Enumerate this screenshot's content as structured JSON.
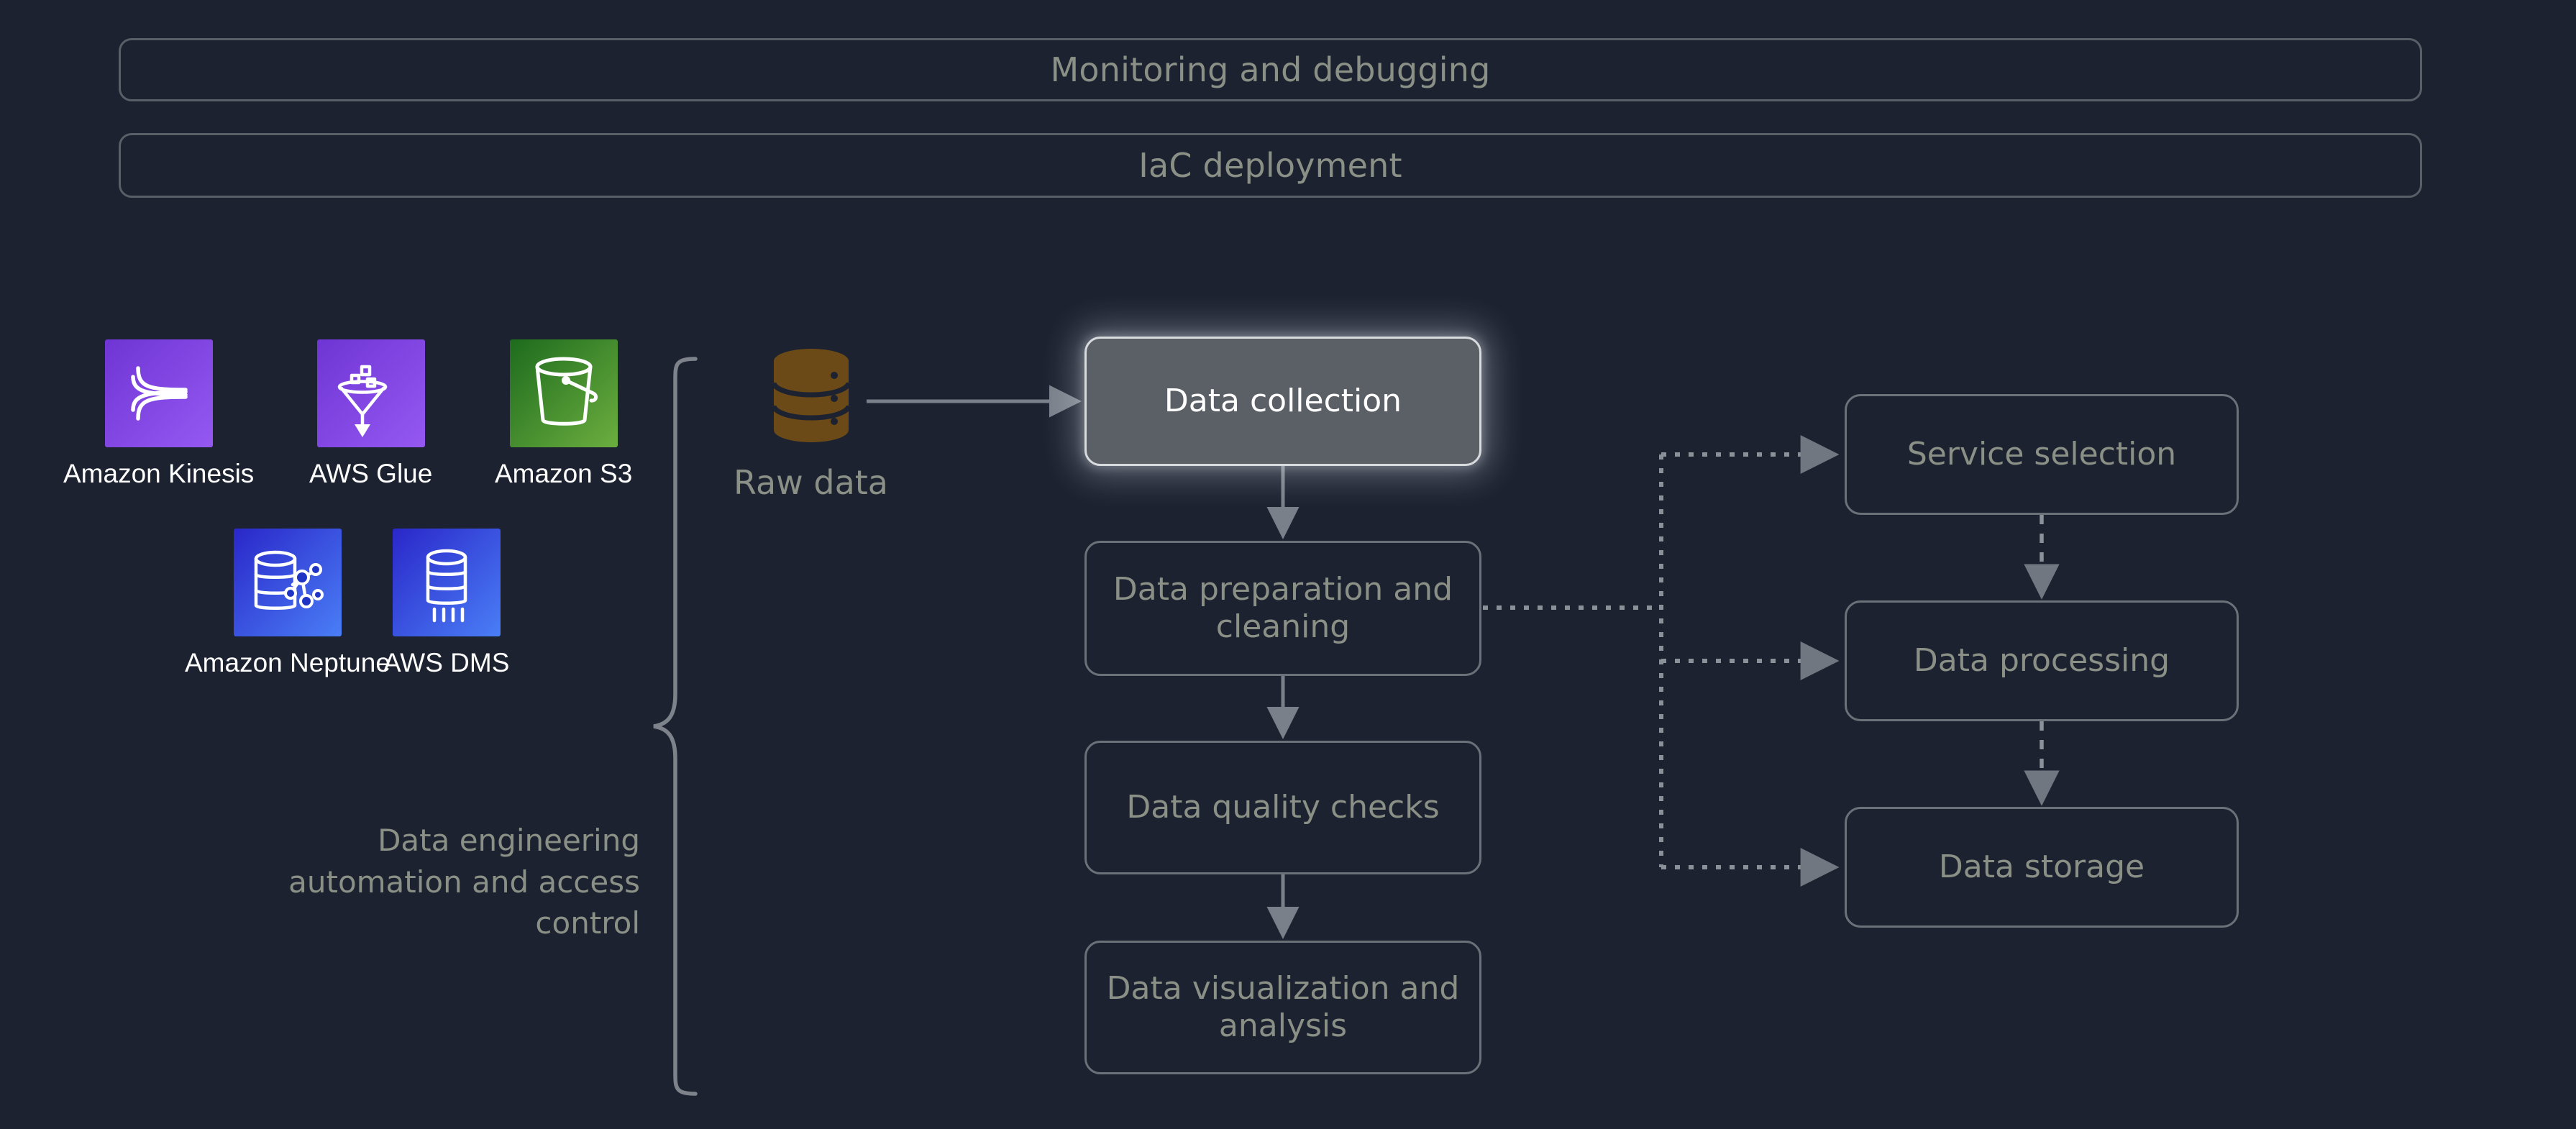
{
  "canvas": {
    "background": "#1c2230"
  },
  "header": {
    "bars": [
      {
        "label": "Monitoring and debugging"
      },
      {
        "label": "IaC deployment"
      }
    ]
  },
  "services": {
    "items": [
      {
        "label": "Amazon Kinesis",
        "icon": "kinesis-icon",
        "color": "#8a4ce8"
      },
      {
        "label": "AWS Glue",
        "icon": "glue-funnel-icon",
        "color": "#8a4ce8"
      },
      {
        "label": "Amazon S3",
        "icon": "s3-bucket-icon",
        "color": "#3f8624"
      },
      {
        "label": "Amazon Neptune",
        "icon": "neptune-graph-database-icon",
        "color": "#3b50e0"
      },
      {
        "label": "AWS DMS",
        "icon": "dms-database-icon",
        "color": "#3b50e0"
      }
    ]
  },
  "grouping": {
    "brace_label": "Data engineering automation and access control",
    "brace_color": "#7e838b"
  },
  "source": {
    "label": "Raw data",
    "icon": "database-cylinder-icon",
    "color": "#6b4a17"
  },
  "pipeline": {
    "steps": [
      {
        "id": "data-collection",
        "label": "Data collection",
        "highlighted": true
      },
      {
        "id": "data-preparation-and-cleaning",
        "label": "Data preparation and cleaning",
        "highlighted": false
      },
      {
        "id": "data-quality-checks",
        "label": "Data quality checks",
        "highlighted": false
      },
      {
        "id": "data-visualization-and-analysis",
        "label": "Data visualization and analysis",
        "highlighted": false
      }
    ]
  },
  "considerations": {
    "steps": [
      {
        "id": "service-selection",
        "label": "Service selection"
      },
      {
        "id": "data-processing",
        "label": "Data processing"
      },
      {
        "id": "data-storage",
        "label": "Data storage"
      }
    ]
  },
  "style": {
    "box_border": "#6b7178",
    "box_text": "#8b9086",
    "highlight_fill": "#5b6067",
    "highlight_text": "#ffffff",
    "arrow_solid": "#7a808a",
    "arrow_dotted": "#8b9199",
    "service_label_text": "#ffffff"
  }
}
